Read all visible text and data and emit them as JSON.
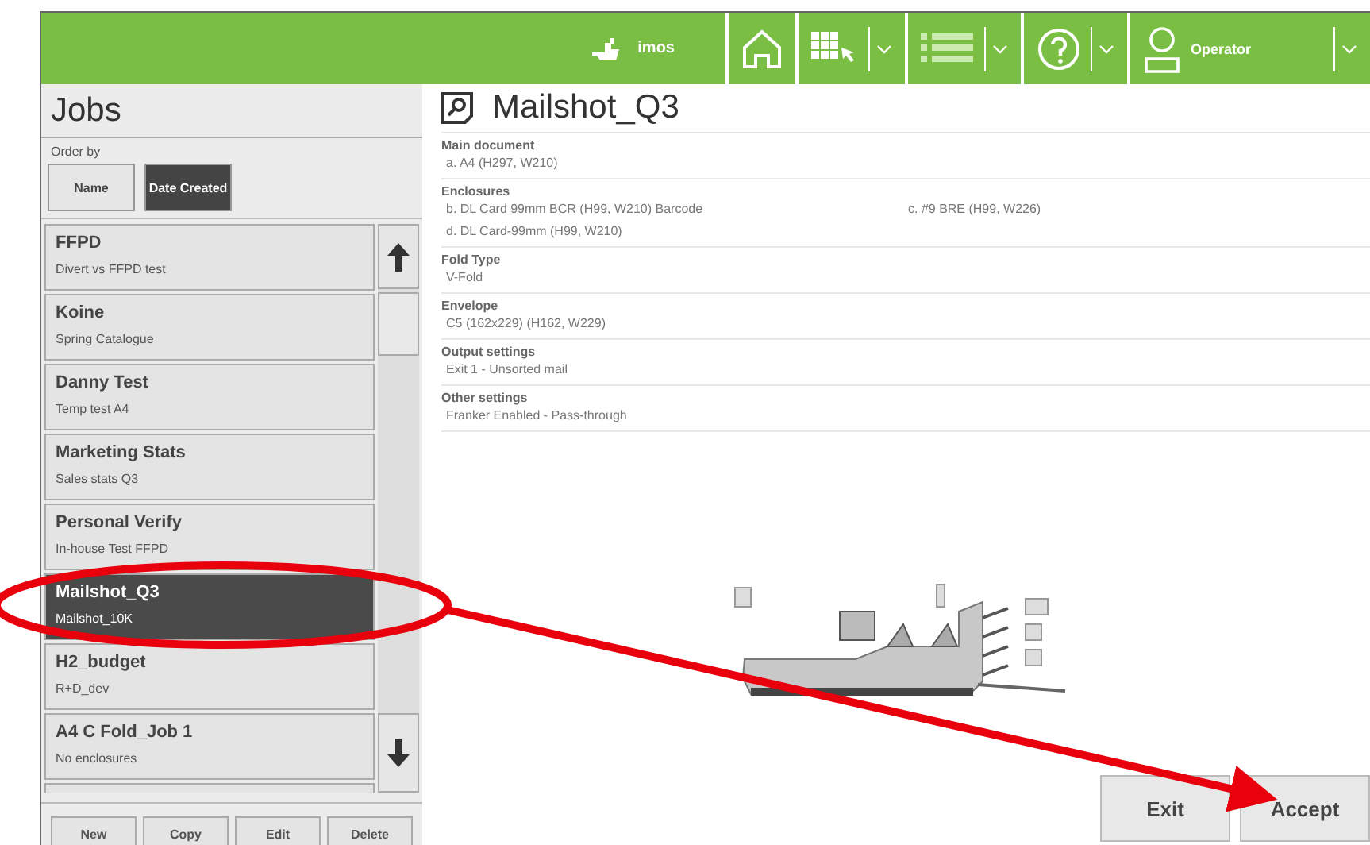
{
  "topbar": {
    "brand": "imos",
    "user": "Operator"
  },
  "jobs": {
    "title": "Jobs",
    "order_label": "Order by",
    "sort_options": [
      {
        "label": "Name",
        "selected": false
      },
      {
        "label": "Date Created",
        "selected": true
      }
    ],
    "items": [
      {
        "name": "FFPD",
        "description": "Divert vs FFPD test",
        "selected": false
      },
      {
        "name": "Koine",
        "description": "Spring Catalogue",
        "selected": false
      },
      {
        "name": "Danny Test",
        "description": "Temp test A4",
        "selected": false
      },
      {
        "name": "Marketing Stats",
        "description": "Sales stats Q3",
        "selected": false
      },
      {
        "name": "Personal Verify",
        "description": "In-house Test FFPD",
        "selected": false
      },
      {
        "name": "Mailshot_Q3",
        "description": "Mailshot_10K",
        "selected": true
      },
      {
        "name": "H2_budget",
        "description": "R+D_dev",
        "selected": false
      },
      {
        "name": "A4 C Fold_Job 1",
        "description": "No enclosures",
        "selected": false
      }
    ],
    "actions": [
      "New",
      "Copy",
      "Edit",
      "Delete"
    ]
  },
  "details": {
    "title": "Mailshot_Q3",
    "sections": [
      {
        "heading": "Main document",
        "values": [
          "a. A4 (H297, W210)"
        ]
      },
      {
        "heading": "Enclosures",
        "values": [
          "b. DL Card 99mm BCR (H99, W210) Barcode",
          "c. #9 BRE (H99, W226)",
          "d. DL Card-99mm (H99, W210)"
        ]
      },
      {
        "heading": "Fold Type",
        "values": [
          "V-Fold"
        ]
      },
      {
        "heading": "Envelope",
        "values": [
          "C5 (162x229) (H162, W229)"
        ]
      },
      {
        "heading": "Output settings",
        "values": [
          "Exit 1 - Unsorted mail"
        ]
      },
      {
        "heading": "Other settings",
        "values": [
          "Franker Enabled - Pass-through"
        ]
      }
    ]
  },
  "buttons": [
    "Exit",
    "Accept"
  ]
}
